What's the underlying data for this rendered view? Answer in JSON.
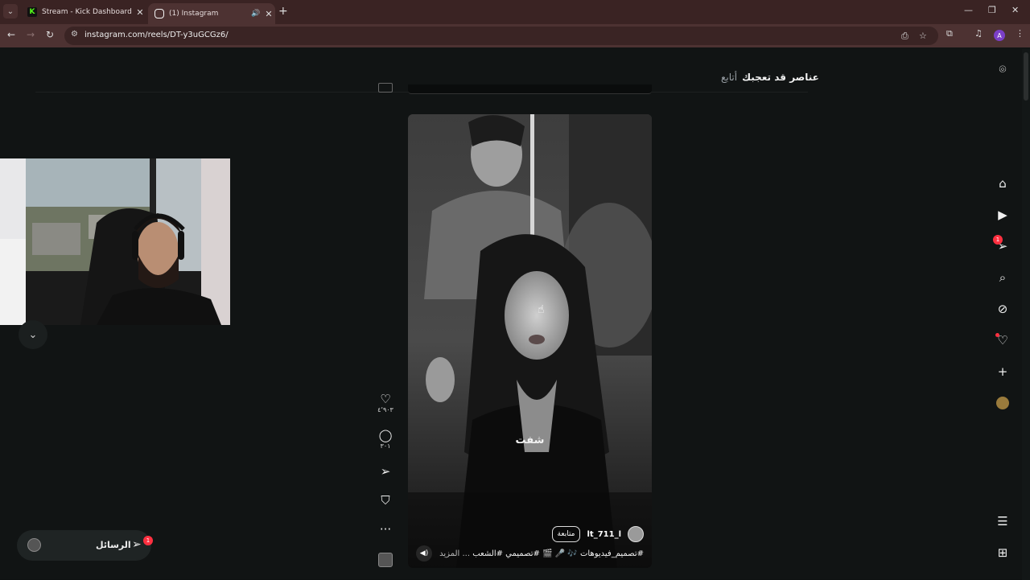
{
  "browser": {
    "tabs": [
      {
        "title": "Stream - Kick Dashboard",
        "favicon": "kick-icon"
      },
      {
        "title": "(1) Instagram",
        "favicon": "instagram-icon"
      }
    ],
    "url": "instagram.com/reels/DT-y3uGCGz6/",
    "profile_initial": "A"
  },
  "suggestions": {
    "heading": "عناصر قد تعجبك",
    "follow_label": "أتابع"
  },
  "reel": {
    "caption_overlay": "شفت",
    "username": "lt_711_l",
    "follow_label": "متابعة",
    "caption_text": "#تصميم_فيديوهات 🎶 🎤 🎬 #تصميمي #الشعب",
    "caption_more": "... المزيد",
    "likes": "٤٬٩٠٣",
    "comments": "٣٠١"
  },
  "messages": {
    "label": "الرسائل",
    "badge": "1"
  },
  "sidebar": {
    "messages_badge": "1"
  },
  "colors": {
    "chrome_bg": "#3a2323",
    "page_bg": "#111414",
    "badge_red": "#ff3040",
    "kick_green": "#53fc18"
  }
}
